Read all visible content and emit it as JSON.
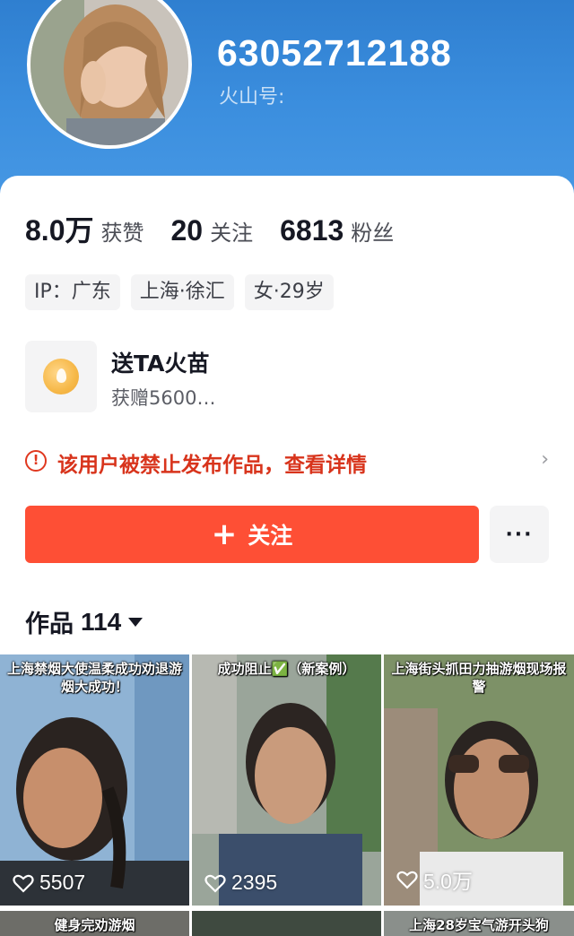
{
  "profile": {
    "user_id": "63052712188",
    "huoshan_label": "火山号:"
  },
  "stats": [
    {
      "value": "8.0万",
      "label": "获赞"
    },
    {
      "value": "20",
      "label": "关注"
    },
    {
      "value": "6813",
      "label": "粉丝"
    }
  ],
  "tags": [
    "IP：广东",
    "上海·徐汇",
    "女·29岁"
  ],
  "gift": {
    "title": "送TA火苗",
    "subtitle": "获赠5600…"
  },
  "notice": {
    "icon_text": "!",
    "text": "该用户被禁止发布作品，查看详情",
    "arrow": "›"
  },
  "actions": {
    "follow_icon": "+",
    "follow_label": "关注",
    "more_label": "···"
  },
  "works": {
    "label": "作品",
    "count": "114"
  },
  "videos": [
    {
      "caption": "上海禁烟大使温柔成功劝退游烟大成功！",
      "likes": "5507"
    },
    {
      "caption": "成功阻止✅（新案例）",
      "likes": "2395"
    },
    {
      "caption": "上海街头抓田力抽游烟现场报警",
      "likes": "5.0万"
    }
  ],
  "videos_row2": [
    {
      "caption": "健身完劝游烟"
    },
    {
      "caption": ""
    },
    {
      "caption": "上海28岁宝气游开头狗"
    }
  ],
  "colors": {
    "header_blue": "#3b8ede",
    "follow_red": "#fe4f35",
    "warning_red": "#d8341c"
  }
}
